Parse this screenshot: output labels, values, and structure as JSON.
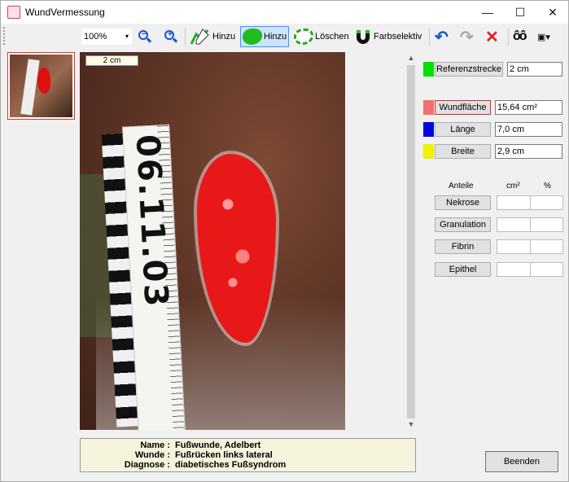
{
  "window": {
    "title": "WundVermessung",
    "min_label": "—",
    "max_label": "☐",
    "close_label": "✕"
  },
  "toolbar": {
    "zoom": "100%",
    "zoom_arrow": "▾",
    "zoom_out_sign": "−",
    "zoom_in_sign": "+",
    "pen_add_label": "Hinzu",
    "area_add_label": "Hinzu",
    "delete_label": "Löschen",
    "color_select_label": "Farbselektiv",
    "undo_glyph": "↶",
    "redo_glyph": "↷",
    "cancel_glyph": "✕",
    "view_glyph": "ôô",
    "export_glyph": "▣▾"
  },
  "image": {
    "scale_label": "2 cm",
    "ruler_text": "06.11.03"
  },
  "scroll": {
    "up": "▲",
    "down": "▼"
  },
  "info": {
    "rows": [
      {
        "key": "Name :",
        "value": "Fußwunde, Adelbert"
      },
      {
        "key": "Wunde :",
        "value": "Fußrücken links lateral"
      },
      {
        "key": "Diagnose :",
        "value": "diabetisches Fußsyndrom"
      }
    ]
  },
  "measure": {
    "reference": {
      "label": "Referenzstrecke",
      "value": "2 cm",
      "color": "#00e000"
    },
    "area": {
      "label": "Wundfläche",
      "value": "15,64 cm²",
      "color": "#f07070"
    },
    "length": {
      "label": "Länge",
      "value": "7,0 cm",
      "color": "#0000e0"
    },
    "width": {
      "label": "Breite",
      "value": "2,9 cm",
      "color": "#f0f000"
    }
  },
  "shares": {
    "headers": {
      "name": "Anteile",
      "cm2": "cm²",
      "pct": "%"
    },
    "rows": [
      {
        "label": "Nekrose",
        "cm2": "",
        "pct": ""
      },
      {
        "label": "Granulation",
        "cm2": "",
        "pct": ""
      },
      {
        "label": "Fibrin",
        "cm2": "",
        "pct": ""
      },
      {
        "label": "Epithel",
        "cm2": "",
        "pct": ""
      }
    ]
  },
  "footer": {
    "close_label": "Beenden"
  }
}
